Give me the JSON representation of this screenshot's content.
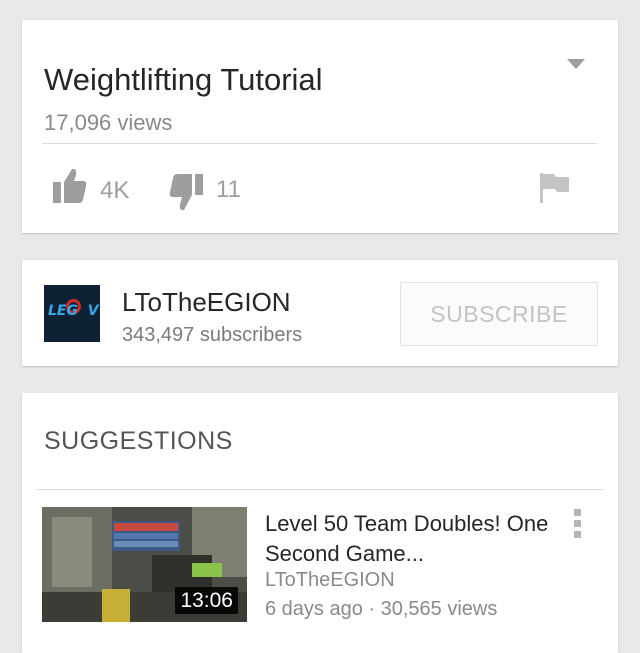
{
  "video": {
    "title": "Weightlifting Tutorial",
    "views": "17,096 views",
    "likes": "4K",
    "dislikes": "11"
  },
  "channel": {
    "name": "LToTheEGION",
    "subscribers": "343,497 subscribers",
    "subscribe_label": "SUBSCRIBE",
    "avatar_text": "LEGION TV"
  },
  "suggestions": {
    "heading": "SUGGESTIONS",
    "items": [
      {
        "title": "Level 50 Team Doubles! One Second Game...",
        "channel": "LToTheEGION",
        "meta": "6 days ago · 30,565 views",
        "duration": "13:06"
      }
    ]
  },
  "icons": {
    "expand": "chevron-down-icon",
    "like": "thumbs-up-icon",
    "dislike": "thumbs-down-icon",
    "flag": "flag-icon",
    "menu": "overflow-menu-icon"
  },
  "colors": {
    "background": "#e9e9e9",
    "card": "#ffffff",
    "primary_text": "#262626",
    "secondary_text": "#8a8a8a",
    "icon_gray": "#9e9e9e"
  }
}
